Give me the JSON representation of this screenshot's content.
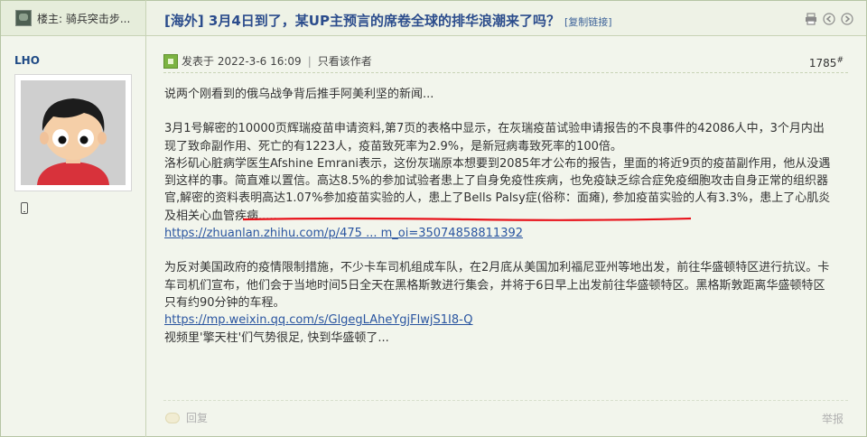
{
  "header": {
    "floor_owner_label": "楼主: 骑兵突击步...",
    "title": "[海外] 3月4日到了，某UP主预言的席卷全球的排华浪潮来了吗？",
    "copy_link": "[复制链接]",
    "icons": [
      "print-icon",
      "prev-arrow-icon",
      "next-arrow-icon"
    ]
  },
  "author": {
    "name": "LHO",
    "device_icon": "mobile-phone-icon"
  },
  "post": {
    "posted_at": "发表于 2022-3-6 16:09",
    "only_author": "只看该作者",
    "floor_number": "1785",
    "floor_suffix": "#",
    "paragraphs": [
      "说两个刚看到的俄乌战争背后推手阿美利坚的新闻...",
      "3月1号解密的10000页辉瑞疫苗申请资料,第7页的表格中显示，在灰瑞疫苗试验申请报告的不良事件的42086人中，3个月内出现了致命副作用、死亡的有1223人，疫苗致死率为2.9%，是新冠病毒致死率的100倍。",
      "洛杉矶心脏病学医生Afshine Emrani表示，这份灰瑞原本想要到2085年才公布的报告，里面的将近9页的疫苗副作用，他从没遇到这样的事。简直难以置信。高达8.5%的参加试验者患上了自身免疫性疾病，也免疫缺乏综合症免疫细胞攻击自身正常的组织器官,解密的资料表明高达1.07%参加疫苗实验的人，患上了Bells Palsy症(俗称：面瘫), 参加疫苗实验的人有3.3%，患上了心肌炎及相关心血管疾病.....",
      "https://zhuanlan.zhihu.com/p/475 ... m_oi=35074858811392",
      "为反对美国政府的疫情限制措施，不少卡车司机组成车队，在2月底从美国加利福尼亚州等地出发，前往华盛顿特区进行抗议。卡车司机们宣布，他们会于当地时间5日全天在黑格斯敦进行集会，并将于6日早上出发前往华盛顿特区。黑格斯敦距离华盛顿特区只有约90分钟的车程。",
      "https://mp.weixin.qq.com/s/GlgegLAheYgjFlwjS1I8-Q",
      "视频里'擎天柱'们气势很足, 快到华盛顿了..."
    ]
  },
  "footer": {
    "reply": "回复",
    "report": "举报"
  },
  "colors": {
    "title_blue": "#2b4c8c",
    "link_blue": "#2a55a0",
    "panel_green": "#f2f5ec",
    "annotation_red": "#e8121a"
  }
}
